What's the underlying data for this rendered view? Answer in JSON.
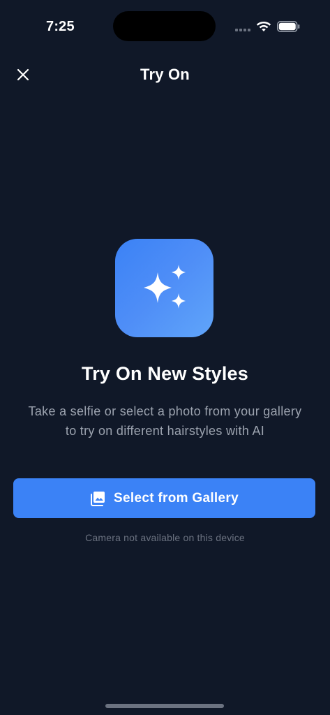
{
  "status_bar": {
    "time": "7:25"
  },
  "nav": {
    "title": "Try On",
    "close_icon": "close-icon"
  },
  "hero": {
    "icon": "sparkles-icon",
    "title": "Try On New Styles",
    "subtitle_line1": "Take a selfie or select a photo from your gallery",
    "subtitle_line2": "to try on different hairstyles with AI"
  },
  "actions": {
    "gallery_button_label": "Select from Gallery",
    "gallery_button_icon": "photo-library-icon",
    "camera_note": "Camera not available on this device"
  },
  "colors": {
    "background": "#101828",
    "accent": "#3b82f6",
    "muted_text": "#9ca3af"
  }
}
